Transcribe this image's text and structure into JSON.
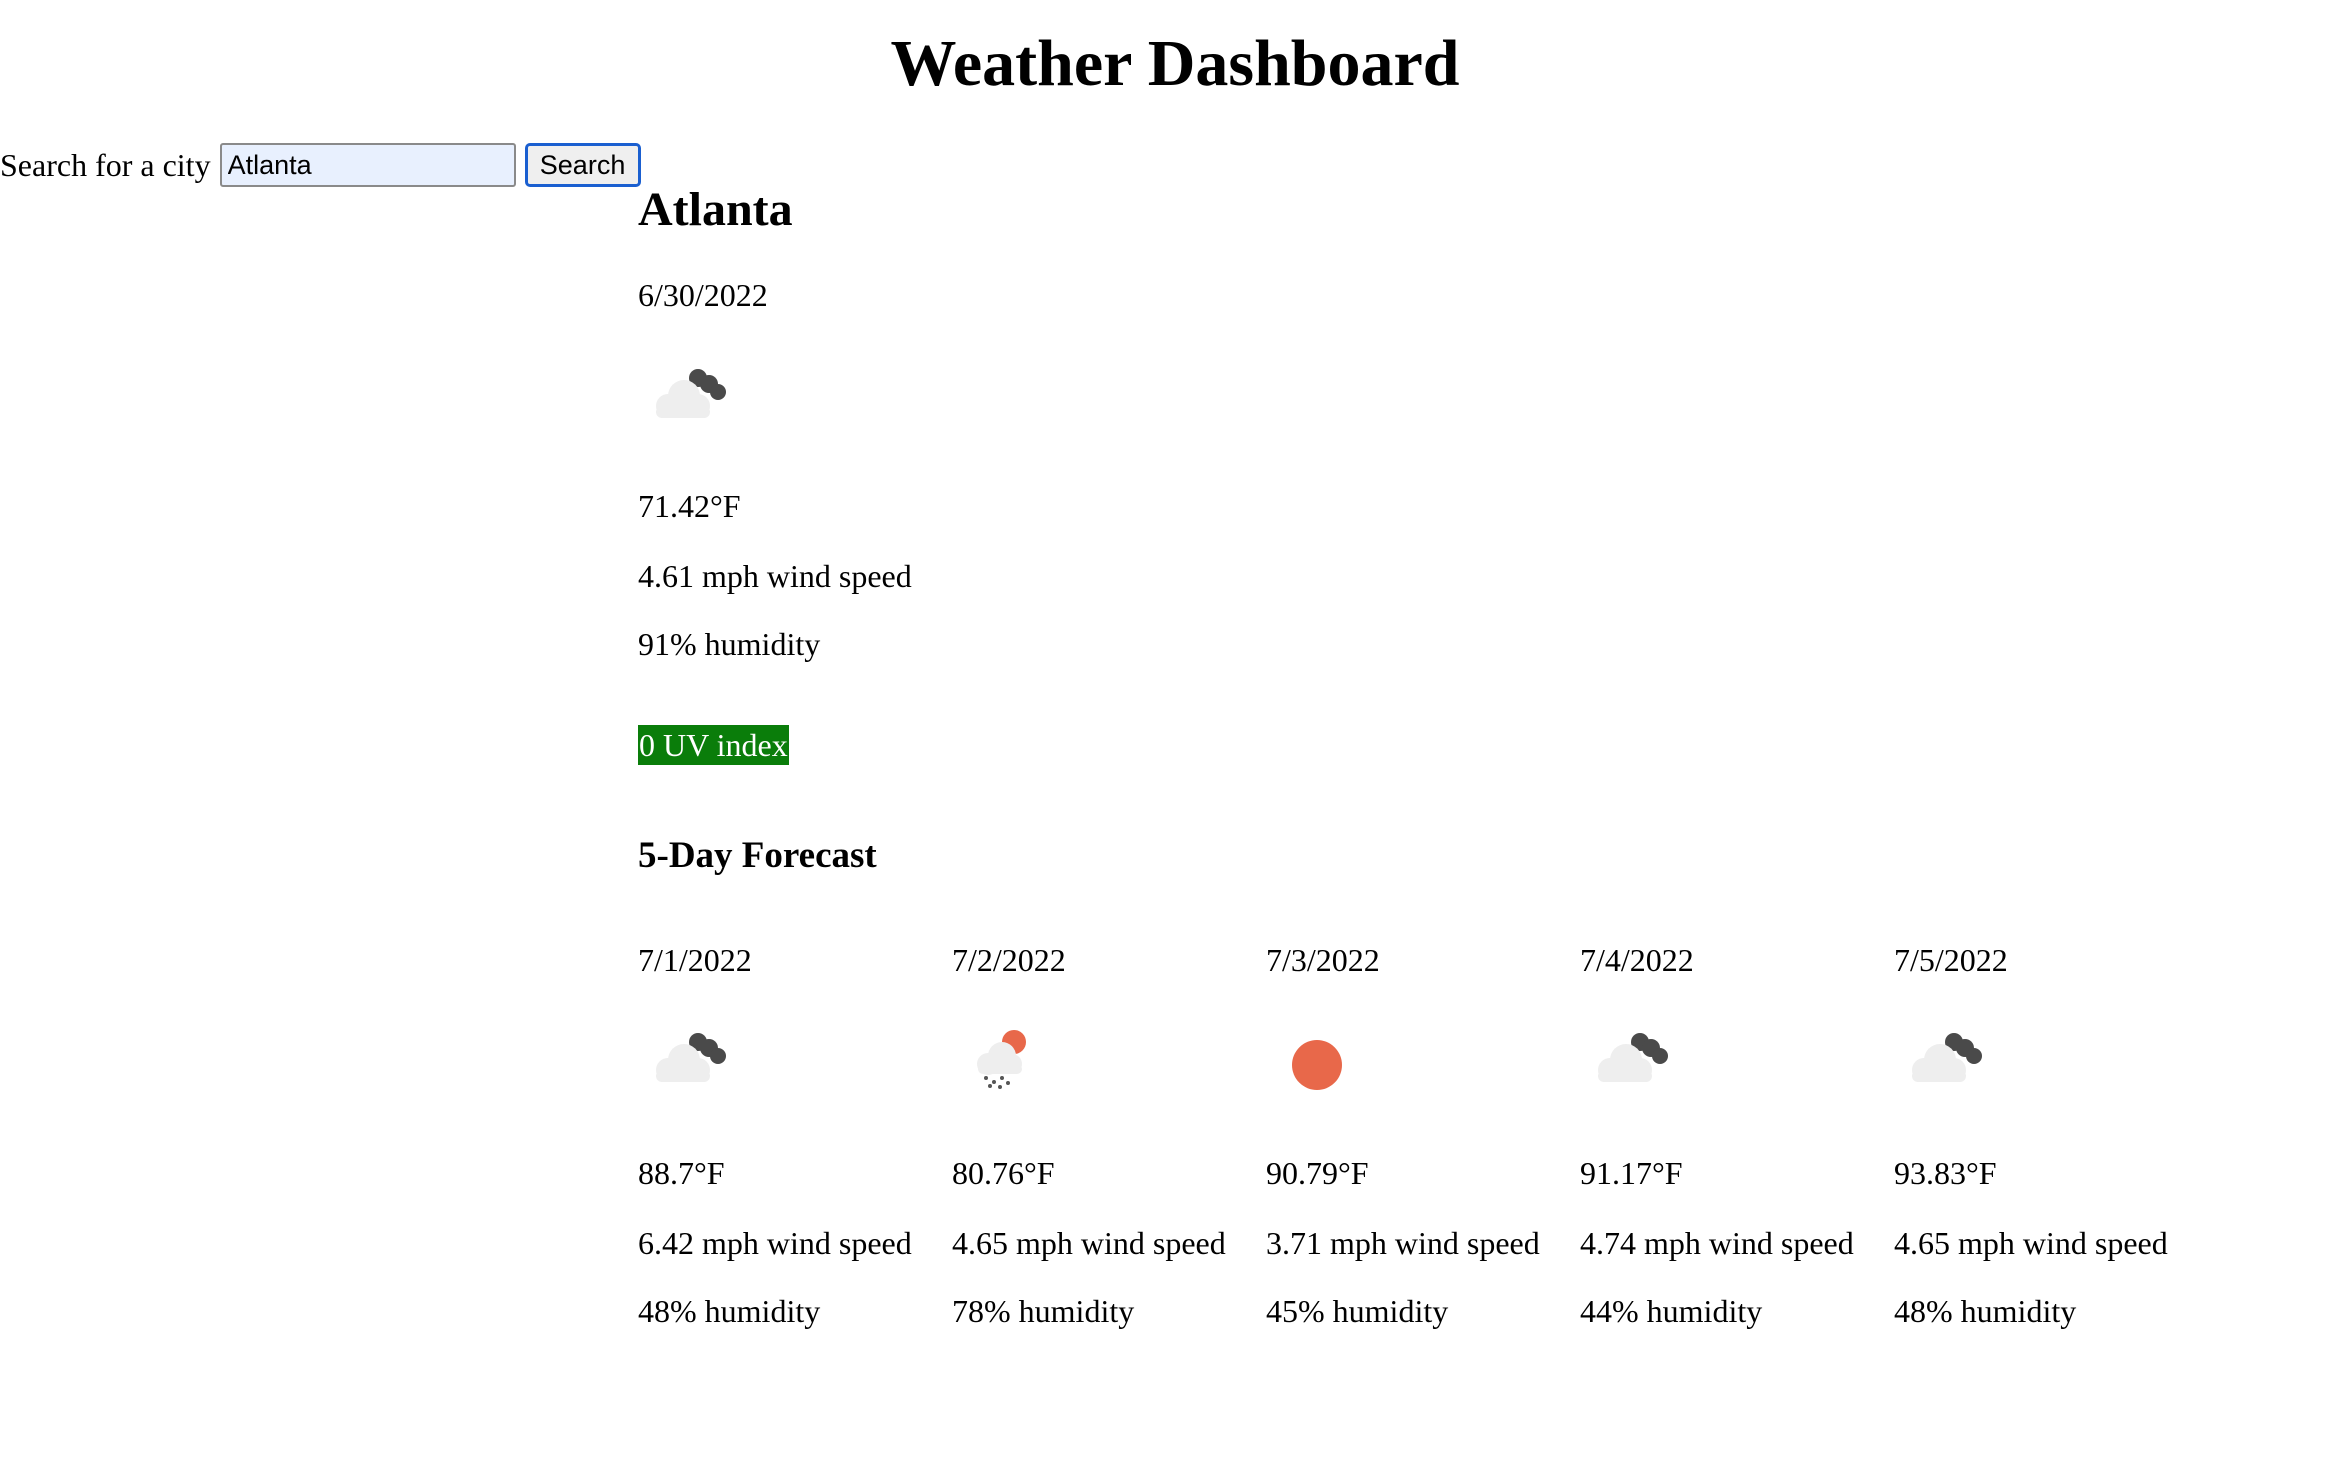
{
  "header": {
    "title": "Weather Dashboard"
  },
  "search": {
    "label": "Search for a city",
    "value": "Atlanta",
    "button_label": "Search"
  },
  "current": {
    "city": "Atlanta",
    "date": "6/30/2022",
    "icon": "broken-clouds-icon",
    "temperature": "71.42°F",
    "wind": "4.61 mph wind speed",
    "humidity": "91% humidity",
    "uv": "0 UV index",
    "uv_color": "#0a7d0a"
  },
  "forecast": {
    "heading": "5-Day Forecast",
    "days": [
      {
        "date": "7/1/2022",
        "icon": "broken-clouds-icon",
        "temperature": "88.7°F",
        "wind": "6.42 mph wind speed",
        "humidity": "48% humidity"
      },
      {
        "date": "7/2/2022",
        "icon": "sun-rain-cloud-icon",
        "temperature": "80.76°F",
        "wind": "4.65 mph wind speed",
        "humidity": "78% humidity"
      },
      {
        "date": "7/3/2022",
        "icon": "sun-icon",
        "temperature": "90.79°F",
        "wind": "3.71 mph wind speed",
        "humidity": "45% humidity"
      },
      {
        "date": "7/4/2022",
        "icon": "broken-clouds-icon",
        "temperature": "91.17°F",
        "wind": "4.74 mph wind speed",
        "humidity": "44% humidity"
      },
      {
        "date": "7/5/2022",
        "icon": "broken-clouds-icon",
        "temperature": "93.83°F",
        "wind": "4.65 mph wind speed",
        "humidity": "48% humidity"
      }
    ]
  },
  "colors": {
    "sun": "#e8684a",
    "dark_cloud": "#4a4a4a",
    "light_cloud": "#eeeeee",
    "button_border": "#1a5fd0",
    "input_background": "#e8f0fe"
  }
}
